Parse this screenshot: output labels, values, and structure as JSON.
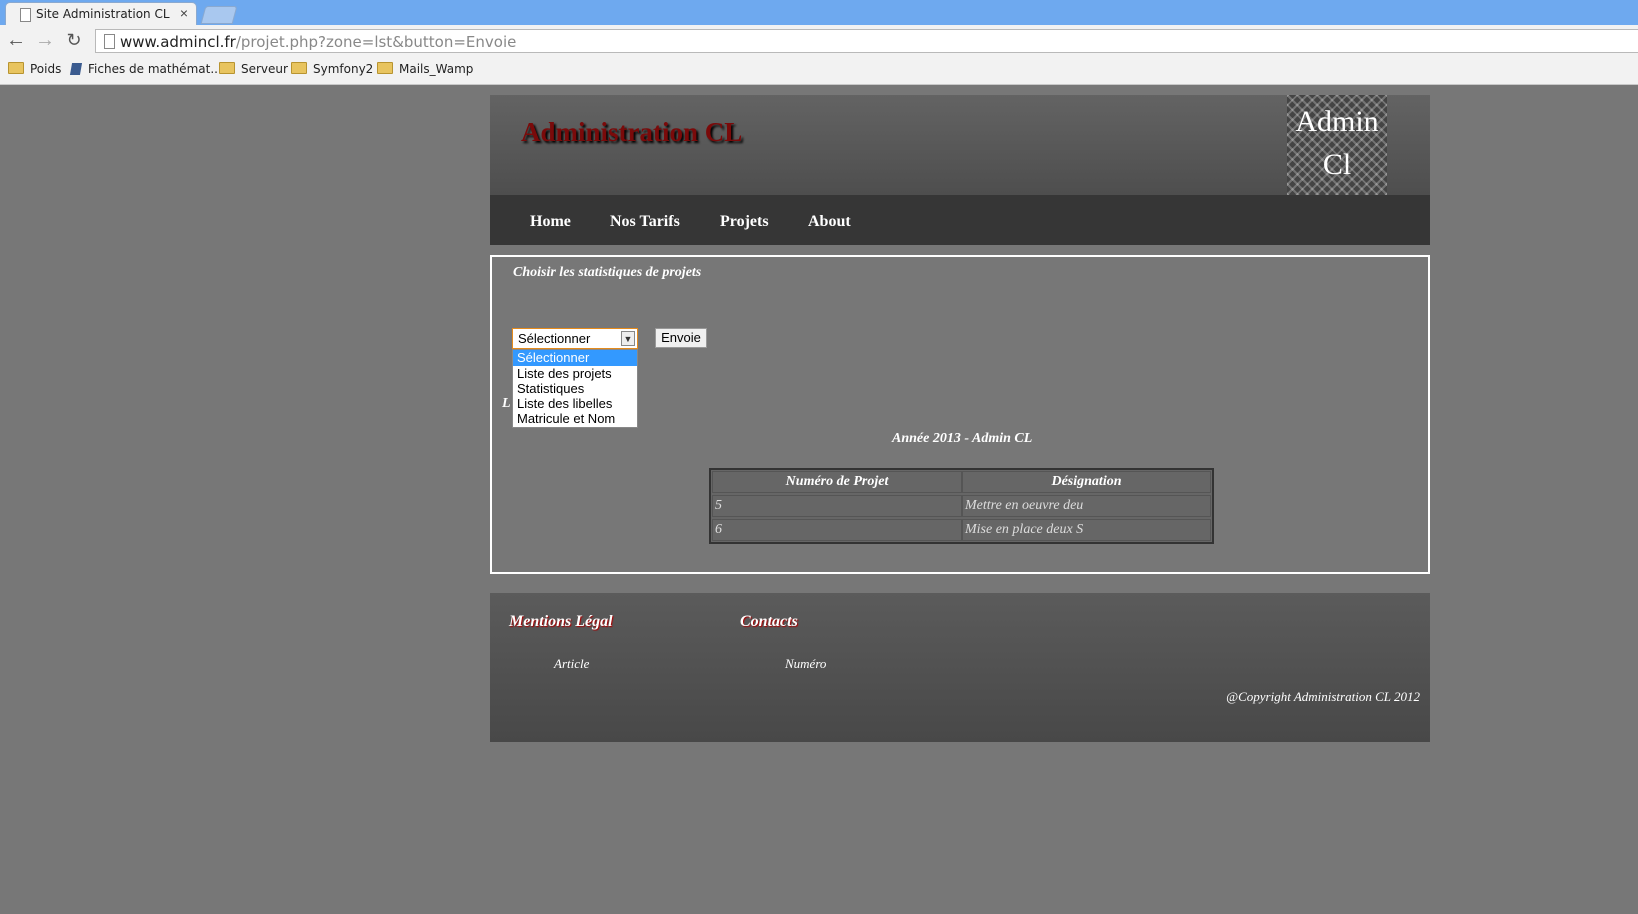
{
  "browser": {
    "tab_title": "Site Administration CL",
    "tab_close": "×",
    "url_domain": "www.admincl.fr",
    "url_path": "/projet.php?zone=lst&button=Envoie",
    "bookmarks": [
      "Poids",
      "Fiches de mathémat...",
      "Serveur",
      "Symfony2",
      "Mails_Wamp"
    ]
  },
  "header": {
    "site_title": "Administration CL",
    "logo_line1": "Admin",
    "logo_line2": "Cl"
  },
  "nav": {
    "items": [
      "Home",
      "Nos Tarifs",
      "Projets",
      "About"
    ]
  },
  "main": {
    "choose_title": "Choisir les statistiques de projets",
    "select_value": "Sélectionner",
    "options": [
      "Sélectionner",
      "Liste des projets",
      "Statistiques",
      "Liste des libelles",
      "Matricule et Nom"
    ],
    "submit_label": "Envoie",
    "hidden_letter": "L",
    "year_caption": "Année 2013 - Admin CL",
    "table": {
      "headers": [
        "Numéro de Projet",
        "Désignation"
      ],
      "rows": [
        [
          "5",
          "Mettre en oeuvre deu"
        ],
        [
          "6",
          "Mise en place deux S"
        ]
      ]
    }
  },
  "footer": {
    "mentions_title": "Mentions Légal",
    "mentions_sub": "Article",
    "contacts_title": "Contacts",
    "contacts_sub": "Numéro",
    "copyright": "@Copyright Administration CL 2012"
  },
  "colors": {
    "page_bg": "#777777",
    "title_red": "#7a0a0a",
    "nav_bg": "#363636",
    "selected_option": "#3399ff"
  }
}
